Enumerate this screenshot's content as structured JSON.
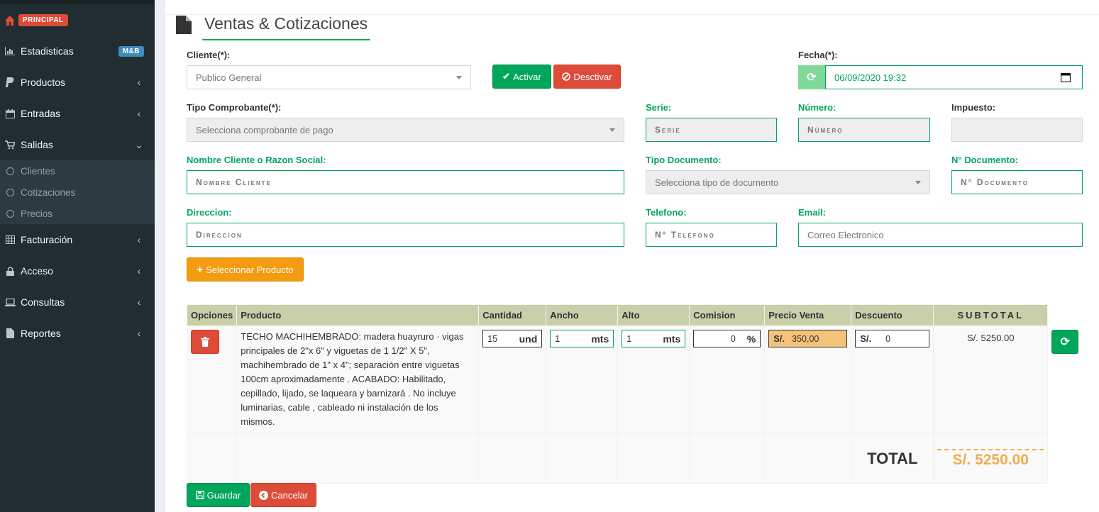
{
  "sidebar": {
    "principal": "PRINCIPAL",
    "items": [
      {
        "label": "Estadisticas",
        "icon": "bar-chart-icon",
        "badge": "M&B"
      },
      {
        "label": "Productos",
        "icon": "paypal-icon"
      },
      {
        "label": "Entradas",
        "icon": "calendar-icon"
      },
      {
        "label": "Salidas",
        "icon": "cart-icon"
      },
      {
        "label": "Facturación",
        "icon": "table-icon"
      },
      {
        "label": "Acceso",
        "icon": "lock-icon"
      },
      {
        "label": "Consultas",
        "icon": "laptop-icon"
      },
      {
        "label": "Reportes",
        "icon": "file-icon"
      }
    ],
    "subitems": [
      "Clientes",
      "Cotizaciones",
      "Precios"
    ]
  },
  "page": {
    "title": "Ventas & Cotizaciones"
  },
  "form": {
    "cliente_label": "Cliente(*):",
    "cliente_value": "Publico General",
    "activar": "Activar",
    "desactivar": "Desctivar",
    "fecha_label": "Fecha(*):",
    "fecha_value": "06/09/2020 19:32",
    "tipo_comprobante_label": "Tipo Comprobante(*):",
    "tipo_comprobante_placeholder": "Selecciona comprobante de pago",
    "serie_label": "Serie:",
    "serie_placeholder": "Serie",
    "numero_label": "Número:",
    "numero_placeholder": "Número",
    "impuesto_label": "Impuesto:",
    "nombre_label": "Nombre Cliente o Razon Social:",
    "nombre_placeholder": "Nombre Cliente",
    "tipo_doc_label": "Tipo Documento:",
    "tipo_doc_placeholder": "Selecciona tipo de documento",
    "ndoc_label": "N° Documento:",
    "ndoc_placeholder": "N° Documento",
    "direccion_label": "Direccion:",
    "direccion_placeholder": "Direccion",
    "telefono_label": "Telefono:",
    "telefono_placeholder": "N° Telefono",
    "email_label": "Email:",
    "email_placeholder": "Correo Electronico",
    "seleccionar_producto": "Seleccionar Producto"
  },
  "table": {
    "headers": [
      "Opciones",
      "Producto",
      "Cantidad",
      "Ancho",
      "Alto",
      "Comision",
      "Precio Venta",
      "Descuento",
      "SUBTOTAL"
    ],
    "row": {
      "producto": "TECHO MACHIHEMBRADO: madera huayruro · vigas principales de 2\"x 6\" y viguetas de 1 1/2\" X 5\", machihembrado de 1\" x 4\"; separación entre viguetas 100cm aproximadamente . ACABADO: Habilitado, cepillado, lijado, se laqueara y barnizará . No incluye luminarias, cable , cableado ni instalación de los mismos.",
      "cantidad": "15",
      "cantidad_unit": "und",
      "ancho": "1",
      "ancho_unit": "mts",
      "alto": "1",
      "alto_unit": "mts",
      "comision": "0",
      "comision_unit": "%",
      "precio_prefix": "S/.",
      "precio": "350,00",
      "descuento_prefix": "S/.",
      "descuento": "0",
      "subtotal": "S/. 5250.00"
    },
    "total_label": "TOTAL",
    "total_value": "S/. 5250.00"
  },
  "actions": {
    "guardar": "Guardar",
    "cancelar": "Cancelar"
  },
  "colors": {
    "green": "#00a65a",
    "red": "#dd4b39",
    "orange": "#f39c12",
    "sidebar": "#222d32",
    "table_header": "#c9cfa8"
  }
}
